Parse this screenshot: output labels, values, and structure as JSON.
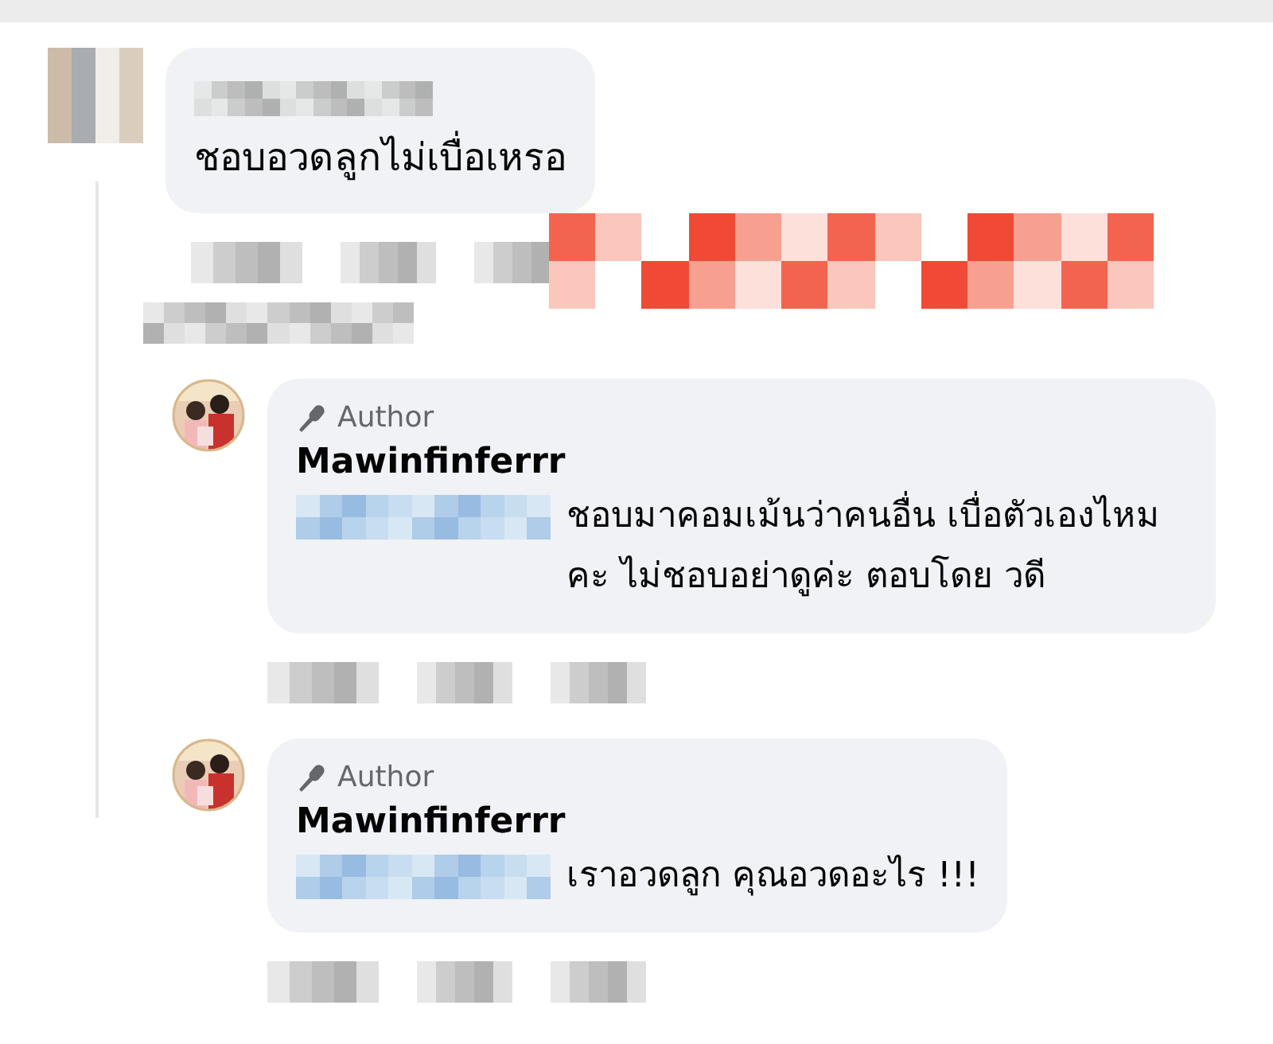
{
  "overlay": {
    "kind": "pixelated-sticker"
  },
  "comments": [
    {
      "kind": "comment",
      "text": "ชอบอวดลูกไม่เบื่อเหรอ"
    },
    {
      "kind": "reply",
      "badge": "Author",
      "name": "Mawinfinferrr",
      "text": "ชอบมาคอมเม้นว่าคนอื่น เบื่อตัวเองไหมคะ ไม่ชอบอย่าดูค่ะ ตอบโดย วดี"
    },
    {
      "kind": "reply",
      "badge": "Author",
      "name": "Mawinfinferrr",
      "text": "เราอวดลูก คุณอวดอะไร !!!"
    }
  ]
}
